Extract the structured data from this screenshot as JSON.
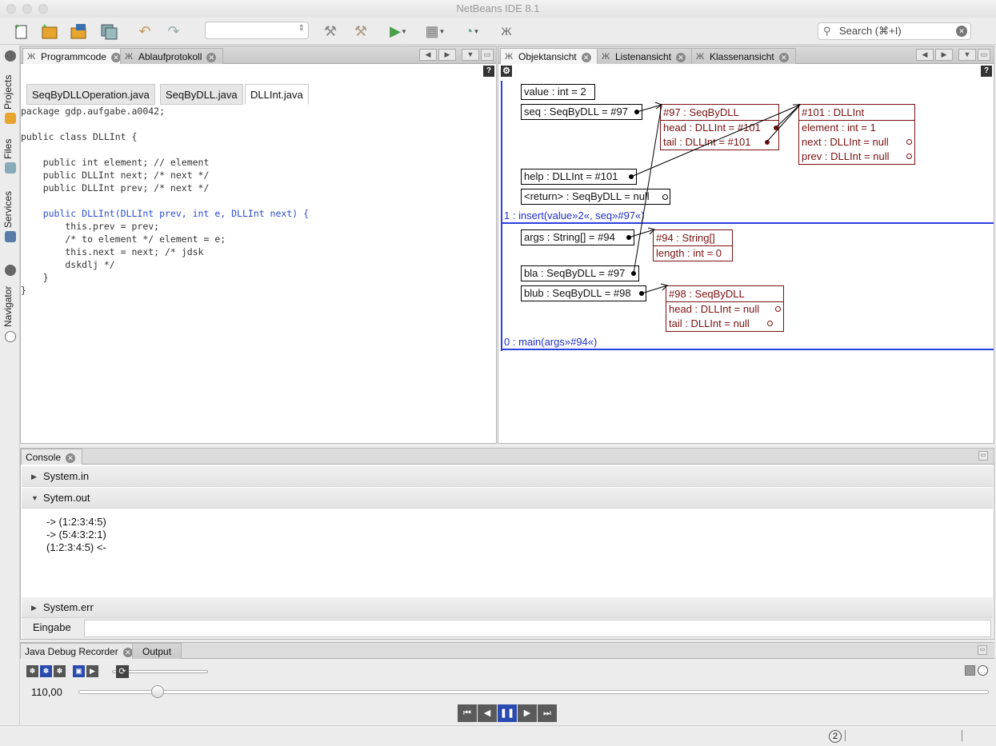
{
  "window": {
    "title": "NetBeans IDE 8.1"
  },
  "toolbar": {
    "search_placeholder": "Search (⌘+I)"
  },
  "left_strip": {
    "projects": "Projects",
    "files": "Files",
    "services": "Services",
    "navigator": "Navigator"
  },
  "editor": {
    "tabs": [
      "Programmcode",
      "Ablaufprotokoll"
    ],
    "file_tabs": [
      "SeqByDLLOperation.java",
      "SeqByDLL.java",
      "DLLInt.java"
    ],
    "code": [
      "package gdp.aufgabe.a0042;",
      "",
      "public class DLLInt {",
      "",
      "    public int element; // element",
      "    public DLLInt next; /* next */",
      "    public DLLInt prev; /* next */",
      "",
      "    public DLLInt(DLLInt prev, int e, DLLInt next) {",
      "        this.prev = prev;",
      "        /* to element */ element = e;",
      "        this.next = next; /* jdsk",
      "        dskdlj */",
      "    }",
      "}"
    ]
  },
  "objview": {
    "tabs": [
      "Objektansicht",
      "Listenansicht",
      "Klassenansicht"
    ],
    "frame1": {
      "vars": [
        "value : int = 2",
        "seq : SeqByDLL = #97",
        "help : DLLInt = #101",
        "<return> : SeqByDLL = null"
      ],
      "label": "1 : insert(value»2«, seq»#97«)"
    },
    "frame0": {
      "vars": [
        "args : String[] = #94",
        "bla : SeqByDLL = #97",
        "blub : SeqByDLL = #98"
      ],
      "label": "0 : main(args»#94«)"
    },
    "obj97": {
      "header": "#97 : SeqByDLL",
      "fields": [
        "head : DLLInt = #101",
        "tail : DLLInt = #101"
      ]
    },
    "obj101": {
      "header": "#101 : DLLInt",
      "fields": [
        "element : int = 1",
        "next : DLLInt = null",
        "prev : DLLInt = null"
      ]
    },
    "obj94": {
      "header": "#94 : String[]",
      "fields": [
        "length : int = 0"
      ]
    },
    "obj98": {
      "header": "#98 : SeqByDLL",
      "fields": [
        "head : DLLInt = null",
        "tail : DLLInt = null"
      ]
    }
  },
  "console": {
    "tab": "Console",
    "sections": [
      "System.in",
      "Sytem.out",
      "System.err"
    ],
    "output": [
      "-> (1:2:3:4:5)",
      "-> (5:4:3:2:1)",
      "(1:2:3:4:5) <-"
    ],
    "input_label": "Eingabe"
  },
  "recorder": {
    "tabs": [
      "Java Debug Recorder",
      "Output"
    ],
    "speed": "110,00",
    "speed_fraction": 0.08
  },
  "status": {
    "badge": "2"
  }
}
